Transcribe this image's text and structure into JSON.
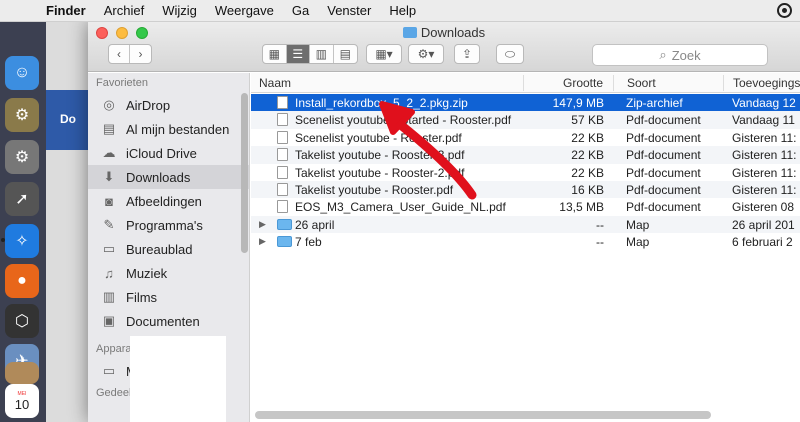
{
  "menubar": {
    "app": "Finder",
    "items": [
      "Archief",
      "Wijzig",
      "Weergave",
      "Ga",
      "Venster",
      "Help"
    ]
  },
  "bg_window": {
    "label": "Do"
  },
  "window": {
    "title": "Downloads",
    "search_placeholder": "Zoek"
  },
  "sidebar": {
    "favorites_heading": "Favorieten",
    "items": [
      {
        "label": "AirDrop",
        "icon": "airdrop-icon"
      },
      {
        "label": "Al mijn bestanden",
        "icon": "all-files-icon"
      },
      {
        "label": "iCloud Drive",
        "icon": "cloud-icon"
      },
      {
        "label": "Downloads",
        "icon": "downloads-icon"
      },
      {
        "label": "Afbeeldingen",
        "icon": "camera-icon"
      },
      {
        "label": "Programma's",
        "icon": "apps-icon"
      },
      {
        "label": "Bureaublad",
        "icon": "desktop-icon"
      },
      {
        "label": "Muziek",
        "icon": "music-icon"
      },
      {
        "label": "Films",
        "icon": "film-icon"
      },
      {
        "label": "Documenten",
        "icon": "documents-icon"
      }
    ],
    "devices_heading": "Appara",
    "devices_item": "M",
    "shared_heading": "Gedeel"
  },
  "list": {
    "columns": {
      "name": "Naam",
      "size": "Grootte",
      "kind": "Soort",
      "date": "Toevoegings"
    },
    "rows": [
      {
        "name": "Install_rekordbox_5_2_2.pkg.zip",
        "size": "147,9 MB",
        "kind": "Zip-archief",
        "date": "Vandaag 12",
        "selected": true,
        "folder": false
      },
      {
        "name": "Scenelist youtube - Started - Rooster.pdf",
        "size": "57 KB",
        "kind": "Pdf-document",
        "date": "Vandaag 11",
        "folder": false
      },
      {
        "name": "Scenelist youtube - Rooster.pdf",
        "size": "22 KB",
        "kind": "Pdf-document",
        "date": "Gisteren 11:",
        "folder": false
      },
      {
        "name": "Takelist youtube - Rooster-3.pdf",
        "size": "22 KB",
        "kind": "Pdf-document",
        "date": "Gisteren 11:",
        "folder": false
      },
      {
        "name": "Takelist youtube - Rooster-2.pdf",
        "size": "22 KB",
        "kind": "Pdf-document",
        "date": "Gisteren 11:",
        "folder": false
      },
      {
        "name": "Takelist youtube - Rooster.pdf",
        "size": "16 KB",
        "kind": "Pdf-document",
        "date": "Gisteren 11:",
        "folder": false
      },
      {
        "name": "EOS_M3_Camera_User_Guide_NL.pdf",
        "size": "13,5 MB",
        "kind": "Pdf-document",
        "date": "Gisteren 08",
        "folder": false
      },
      {
        "name": "26 april",
        "size": "--",
        "kind": "Map",
        "date": "26 april 201",
        "folder": true
      },
      {
        "name": "7 feb",
        "size": "--",
        "kind": "Map",
        "date": "6 februari 2",
        "folder": true
      }
    ]
  },
  "dock": {
    "calendar_day": "10"
  },
  "colors": {
    "selection": "#1062d4",
    "arrow": "#e0101c"
  }
}
